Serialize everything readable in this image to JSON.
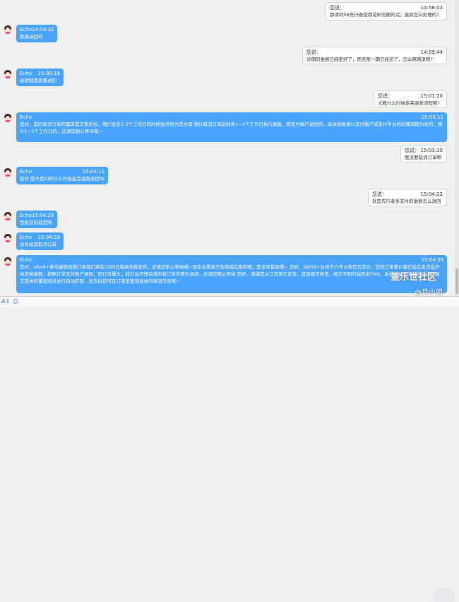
{
  "messages": [
    {
      "side": "out",
      "sender": "您说：",
      "time": "14:58:03",
      "text": "那请问S9先行者使用花呗分期的话，退款怎么处理的?"
    },
    {
      "side": "in",
      "sender": "Echo",
      "time": "14:58:32",
      "text": "原路退回的"
    },
    {
      "side": "out",
      "sender": "您说：",
      "time": "14:59:44",
      "text": "分期的金额已经定好了，而且第一期已经还了，怎么原路退呢?"
    },
    {
      "side": "in",
      "sender": "Echo",
      "time": "15:00:19",
      "text": "退款都是原路退回"
    },
    {
      "side": "out",
      "sender": "您说：",
      "time": "15:01:20",
      "text": "大概什么时候走完退款流程呢?"
    },
    {
      "side": "in",
      "sender": "Echo",
      "time": "15:03:11",
      "text": "您好，您的取消订单的需求提交售后后，我们会在1-3个工作日的时间会尽快为您办理 预计取消订单后财务1~3个工作日执行退款，原支付账户退回的，具体到账请以支付账户或支付平台的结算周期为准的，预计1~5个工作日的，还请您耐心等待哦~"
    },
    {
      "side": "out",
      "sender": "您说：",
      "time": "15:03:30",
      "text": "我没要取消订单啊"
    },
    {
      "side": "in",
      "sender": "Echo",
      "time": "15:04:11",
      "text": "您好 您不是问的什么时候走完退款流程吗"
    },
    {
      "side": "out",
      "sender": "您说：",
      "time": "15:04:22",
      "text": "就是先行者多支付的金额怎么退回"
    },
    {
      "side": "in",
      "sender": "Echo",
      "time": "15:04:29",
      "text": "回复您的就是啊"
    },
    {
      "side": "in",
      "sender": "Echo",
      "time": "15:04:29",
      "text": "没有给您取消订单啊"
    },
    {
      "side": "in",
      "sender": "Echo",
      "time": "15:04:39",
      "text": "您好，s9/s9+参与尝鲜抢购订单我们将在3月9日陆续安排发货，还请您耐心等待哦~现在全渠道只有商城在售的呢，是全球首发哦~ 您好，S9/S9+价格于六号公布官方定价，您的订单差价我们会在发货后开始安排退款，按照订单支付账户退回，因订单量大，我们会尽快完成所有订单的差价退还，还请您耐心等待 您好，商城是从江苏吴江发货，首选顺丰快递，顺丰不到的会转发EMS，系统根据您的收货地址和顺丰提供的覆盖网点进行自动匹配，发货后您可在订单里查询具体的物流信息哦~"
    }
  ],
  "toolbar": {
    "font_btn": "A⇕",
    "emoji_btn": "☺"
  },
  "watermark": {
    "line1": "盖乐世社区",
    "line2": "@月小姐"
  }
}
